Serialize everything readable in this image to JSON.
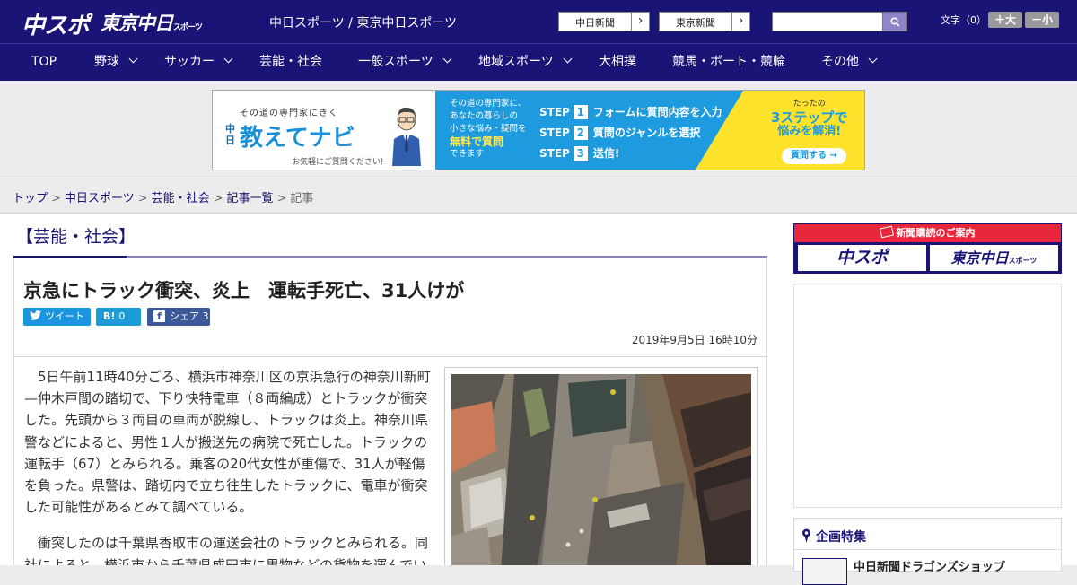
{
  "header": {
    "logo_chuspo": "中スポ",
    "logo_tokyo": "東京中日",
    "logo_tokyo_suffix": "スポーツ",
    "site_title": "中日スポーツ / 東京中日スポーツ",
    "link_chunichi": "中日新聞",
    "link_tokyo": "東京新聞",
    "link_arrow": "›",
    "search_placeholder": "",
    "fontsize_label": "文字（0）",
    "font_bigger": "＋大",
    "font_smaller": "－小"
  },
  "nav": {
    "items": [
      {
        "label": "TOP",
        "dropdown": false
      },
      {
        "label": "野球",
        "dropdown": true
      },
      {
        "label": "サッカー",
        "dropdown": true
      },
      {
        "label": "芸能・社会",
        "dropdown": false
      },
      {
        "label": "一般スポーツ",
        "dropdown": true
      },
      {
        "label": "地域スポーツ",
        "dropdown": true
      },
      {
        "label": "大相撲",
        "dropdown": false
      },
      {
        "label": "競馬・ボート・競輪",
        "dropdown": false
      },
      {
        "label": "その他",
        "dropdown": true
      }
    ]
  },
  "ad": {
    "sub": "その道の専門家にきく",
    "chu": "中日",
    "title": "教えてナビ",
    "note": "お気軽にご質問ください!",
    "mid_line1": "その道の専門家に、",
    "mid_line2": "あなたの暮らしの",
    "mid_line3": "小さな悩み・疑問を",
    "mid_highlight": "無料で質問",
    "mid_line5": "できます",
    "steps": [
      {
        "label": "STEP",
        "num": "1",
        "text": "フォームに質問内容を入力"
      },
      {
        "label": "STEP",
        "num": "2",
        "text": "質問のジャンルを選択"
      },
      {
        "label": "STEP",
        "num": "3",
        "text": "送信!"
      }
    ],
    "right_small": "たったの",
    "right_big": "3ステップで",
    "right_mid": "悩みを解消!",
    "cta": "質問する →"
  },
  "breadcrumb": {
    "items": [
      "トップ",
      "中日スポーツ",
      "芸能・社会",
      "記事一覧"
    ],
    "sep": ">",
    "current": "記事"
  },
  "article": {
    "category": "【芸能・社会】",
    "title": "京急にトラック衝突、炎上　運転手死亡、31人けが",
    "share_twitter": "ツイート",
    "share_twitter_icon": "twitter-bird",
    "share_hatena_icon": "B!",
    "share_hatena_count": "0",
    "share_facebook": "シェア",
    "share_facebook_icon": "f",
    "share_facebook_count": "3",
    "date": "2019年9月5日 16時10分",
    "paragraphs": [
      "5日午前11時40分ごろ、横浜市神奈川区の京浜急行の神奈川新町—仲木戸間の踏切で、下り快特電車（８両編成）とトラックが衝突した。先頭から３両目の車両が脱線し、トラックは炎上。神奈川県警などによると、男性１人が搬送先の病院で死亡した。トラックの運転手（67）とみられる。乗客の20代女性が重傷で、31人が軽傷を負った。県警は、踏切内で立ち往生したトラックに、電車が衝突した可能性があるとみて調べている。",
      "衝突したのは千葉県香取市の運送会社のトラックとみられる。同社によると、横浜市から千葉県成田市に果物などの貨物を運んでいたという。"
    ]
  },
  "sidebar": {
    "subscribe_head": "新聞購読のご案内",
    "subscribe_logo1": "中スポ",
    "subscribe_logo2": "東京中日",
    "subscribe_logo2_suffix": "スポーツ",
    "feature_title": "企画特集",
    "feature_item": "中日新聞ドラゴンズショップ"
  },
  "colors": {
    "brand": "#1a1476",
    "accent_red": "#e8273a",
    "twitter": "#1b95e0",
    "facebook": "#3b5998"
  }
}
